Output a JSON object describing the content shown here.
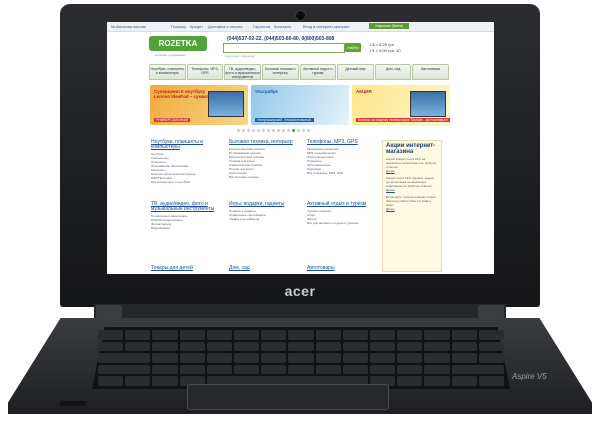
{
  "laptop": {
    "brand": "acer",
    "model": "Aspire V5"
  },
  "site": {
    "topbar": {
      "mobile": "Мобильная версия",
      "help": "Помощь",
      "credit": "Кредит",
      "delivery": "Доставка и оплата",
      "warranty": "Гарантия",
      "contacts": "Контакты",
      "shops": "Вход в интернет-магазин",
      "city": "Харьков (Киев)"
    },
    "logo": "ROZETKA",
    "logo_sub": "интернет-супермаркет",
    "phones": "(044)537-02-22, (044)503-80-80, 0(800)503-808",
    "search_button": "Найти",
    "search_hint": "Например, Наушники",
    "cart": {
      "line1": "1 $ = 8.25 грн",
      "line2": "1 € = 9.00 грн, 10"
    },
    "nav": [
      "Ноутбуки, планшеты и компьютеры",
      "Телефоны, MP3, GPS",
      "ТВ, аудио/видео, фото и музыкальные инструменты",
      "Бытовая техника и интерьер",
      "Активный отдых и туризм",
      "Детский мир",
      "Дом, сад",
      "Автотовары"
    ],
    "banners": [
      {
        "title": "Суперцена! К ноутбуку Lenovo IdeaPad – сумка!",
        "tag": "УНИВЕРСАЛЬНЫЙ",
        "price": "3131"
      },
      {
        "title": "Ультрабук",
        "tag": "Ультраширокий. Ультрастильный."
      },
      {
        "title": "АКЦИЯ",
        "tag": "Бонусы за покупку телевизоров Toshiba - фотоаппарат!"
      }
    ],
    "categories": [
      {
        "title": "Ноутбуки, планшеты и компьютеры",
        "items": [
          "Ноутбуки",
          "Компьютеры",
          "Планшеты",
          "Программное обеспечение",
          "Мониторы",
          "Компьютерные комплектующие",
          "МФУ/Принтеры",
          "Все компьютеры и ноутбуки"
        ]
      },
      {
        "title": "Бытовая техника, интерьер",
        "items": [
          "Крупная бытовая техника",
          "Встраиваемая техника",
          "Мелкая бытовая техника",
          "Техника для кухни",
          "Климатическая техника",
          "Посуда для кухни",
          "Светильники",
          "Вся бытовая техника"
        ]
      },
      {
        "title": "Телефоны, MP3, GPS",
        "items": [
          "Мобильные телефоны",
          "MP3 и медиаплееры",
          "Электронные книги",
          "Планшеты",
          "GPS-навигаторы",
          "Наушники",
          "Все телефоны, MP3, GPS"
        ]
      },
      {
        "title": "ТВ, аудио/видео, фото и музыкальные инструменты",
        "items": [
          "Телевизоры и аксессуары",
          "DVD/HD-видеоплееры",
          "Фотоаппараты",
          "Видеокамеры"
        ]
      },
      {
        "title": "Игры, подарки, гаджеты",
        "items": [
          "Подарки и гаджеты",
          "Подарочные сертификаты",
          "Товары для геймеров"
        ]
      },
      {
        "title": "Активный отдых и туризм",
        "items": [
          "Туризм и кемпинг",
          "Спорт",
          "Фитнес",
          "Все для активного отдыха и туризма"
        ]
      },
      {
        "title": "Товары для детей",
        "items": []
      },
      {
        "title": "Дом, сад",
        "items": []
      },
      {
        "title": "Автотовары",
        "items": []
      }
    ],
    "side": {
      "title": "Акции интернет-магазина",
      "text1": "Акция! Кредит под 0.01% на акционные телевизоры LG, Optimus и Nexus!",
      "text2": "Кредит под 0.01% годовых, кредит до 12 месяцев на акционные смартфоны LG Optimus и Nexus!",
      "text3": "Встречайте лучшую новинку осени! Samsung Galaxy Note 3 и Galaxy Gear!",
      "link": "Далее"
    }
  }
}
